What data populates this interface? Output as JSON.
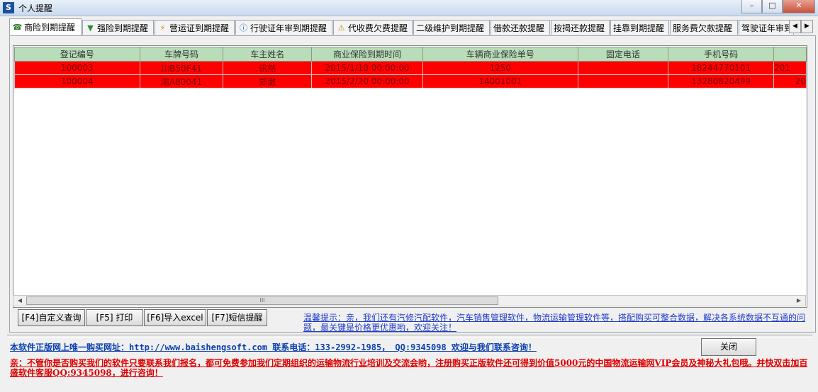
{
  "window": {
    "icon_label": "S",
    "title": "个人提醒",
    "min": "–",
    "max": "□",
    "close": "✕"
  },
  "tabs": [
    {
      "icon": "☎",
      "label": "商险到期提醒"
    },
    {
      "icon": "▼",
      "label": "强险到期提醒"
    },
    {
      "icon": "⚡",
      "label": "营运证到期提醒"
    },
    {
      "icon": "ⓘ",
      "label": "行驶证年审到期提醒"
    },
    {
      "icon": "⚠",
      "label": "代收费欠费提醒"
    },
    {
      "label": "二级维护到期提醒"
    },
    {
      "label": "借款还款提醒"
    },
    {
      "label": "按揭还款提醒"
    },
    {
      "label": "挂靠到期提醒"
    },
    {
      "label": "服务费欠款提醒"
    },
    {
      "label": "驾驶证年审到期提醒"
    }
  ],
  "tab_scroll": {
    "left": "◀",
    "right": "▶"
  },
  "table": {
    "columns": [
      "登记编号",
      "车牌号码",
      "车主姓名",
      "商业保险到期时间",
      "车辆商业保险单号",
      "固定电话",
      "手机号码",
      ""
    ],
    "rows": [
      [
        "100003",
        "川B50F41",
        "讯然",
        "2015/1/10 00:00:00",
        "1250",
        "",
        "18244770101",
        "201"
      ],
      [
        "100004",
        "渝A80041",
        "郑激",
        "2015/2/20 00:00:00",
        "14001001",
        "",
        "13280820499",
        "20"
      ]
    ]
  },
  "hscroll": {
    "left": "◀",
    "right": "▶",
    "grip": "III"
  },
  "buttons": {
    "custom_query": "[F4]自定义查询",
    "print": "[F5] 打印",
    "export_excel": "[F6]导入excel",
    "sms": "[F7]短信提醒",
    "close": "关闭"
  },
  "tip": "温馨提示：亲，我们还有汽修汽配软件，汽车销售管理软件，物流运输管理软件等，搭配购买可整合数据，解决各系统数据不互通的问题，最关键是价格更优惠哟，欢迎关注！",
  "footer": {
    "website_line": "本软件正版网上唯一购买网址：http://www.baishengsoft.com  联系电话：133-2992-1985， QQ:9345098 欢迎与我们联系咨询！",
    "promo": "亲：不管你是否购买我们的软件只要联系我们报名，都可免费参加我们定期组织的运输物流行业培训及交流会哟，注册购买正版软件还可得到价值5000元的中国物流运输网VIP会员及神秘大礼包哦。并快双击加百盛软件客服QQ:9345098，进行咨询！"
  },
  "colors": {
    "row_bg": "#ff0000",
    "header_bg": "#b9dcb9",
    "tip": "#1f3cc9",
    "promo": "#e00000"
  }
}
